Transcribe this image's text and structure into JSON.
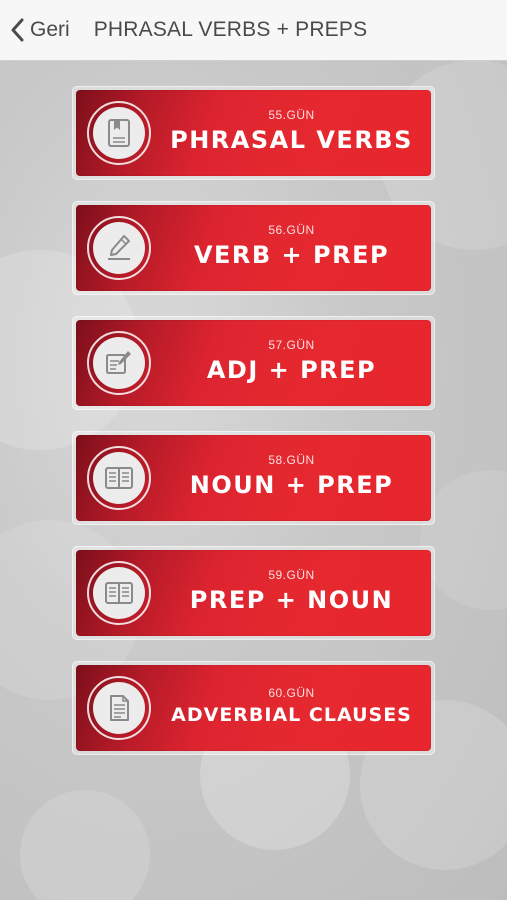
{
  "navbar": {
    "back_label": "Geri",
    "title": "PHRASAL VERBS + PREPS"
  },
  "items": [
    {
      "day": "55.GÜN",
      "title": "PHRASAL VERBS",
      "icon": "bookmark-book-icon"
    },
    {
      "day": "56.GÜN",
      "title": "VERB + PREP",
      "icon": "pen-writing-icon"
    },
    {
      "day": "57.GÜN",
      "title": "ADJ + PREP",
      "icon": "edit-note-icon"
    },
    {
      "day": "58.GÜN",
      "title": "NOUN + PREP",
      "icon": "open-book-icon"
    },
    {
      "day": "59.GÜN",
      "title": "PREP + NOUN",
      "icon": "open-book-icon"
    },
    {
      "day": "60.GÜN",
      "title": "ADVERBIAL CLAUSES",
      "icon": "document-icon"
    }
  ],
  "colors": {
    "card_red": "#e5282f",
    "card_dark": "#7c0f1b",
    "icon_grey": "#8a8a8a"
  }
}
